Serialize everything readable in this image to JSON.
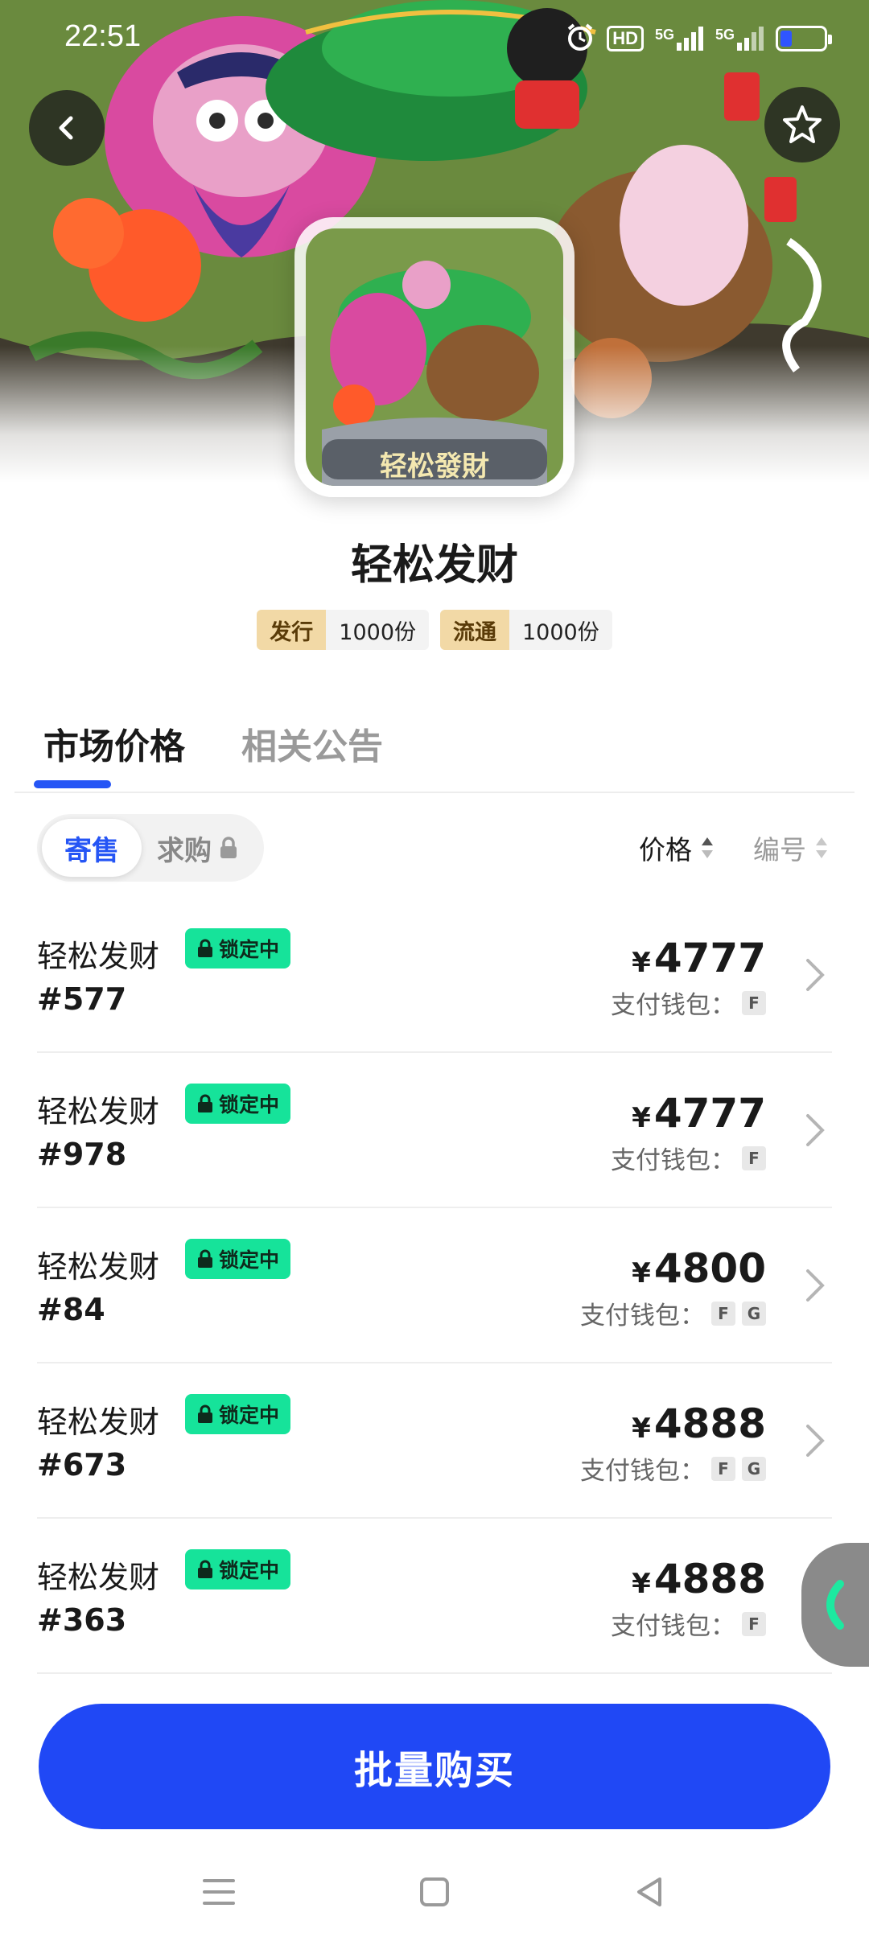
{
  "status_bar": {
    "time": "22:51",
    "icons": [
      "alarm-icon",
      "hd-icon",
      "5g-signal-icon",
      "5g-signal-icon",
      "battery-icon"
    ],
    "hd_label": "HD",
    "net1": "5G",
    "net2": "5G"
  },
  "cover": {
    "banner_text": "轻松發財"
  },
  "product": {
    "title": "轻松发财",
    "issue_label": "发行",
    "issue_value": "1000份",
    "circulation_label": "流通",
    "circulation_value": "1000份"
  },
  "tabs": [
    {
      "label": "市场价格",
      "active": true
    },
    {
      "label": "相关公告",
      "active": false
    }
  ],
  "segment": {
    "sell_label": "寄售",
    "buy_label": "求购"
  },
  "sort": {
    "price_label": "价格",
    "number_label": "编号"
  },
  "listings": [
    {
      "name": "轻松发财",
      "badge": "锁定中",
      "serial": "#577",
      "currency": "¥",
      "price": "4777",
      "wallet_label": "支付钱包：",
      "wallets": [
        "F"
      ]
    },
    {
      "name": "轻松发财",
      "badge": "锁定中",
      "serial": "#978",
      "currency": "¥",
      "price": "4777",
      "wallet_label": "支付钱包：",
      "wallets": [
        "F"
      ]
    },
    {
      "name": "轻松发财",
      "badge": "锁定中",
      "serial": "#84",
      "currency": "¥",
      "price": "4800",
      "wallet_label": "支付钱包：",
      "wallets": [
        "F",
        "G"
      ]
    },
    {
      "name": "轻松发财",
      "badge": "锁定中",
      "serial": "#673",
      "currency": "¥",
      "price": "4888",
      "wallet_label": "支付钱包：",
      "wallets": [
        "F",
        "G"
      ]
    },
    {
      "name": "轻松发财",
      "badge": "锁定中",
      "serial": "#363",
      "currency": "¥",
      "price": "4888",
      "wallet_label": "支付钱包：",
      "wallets": [
        "F"
      ]
    }
  ],
  "cta": {
    "label": "批量购买"
  },
  "colors": {
    "accent": "#2048f5",
    "lock_badge": "#16e39a",
    "tag_key": "#f2d9a6"
  }
}
